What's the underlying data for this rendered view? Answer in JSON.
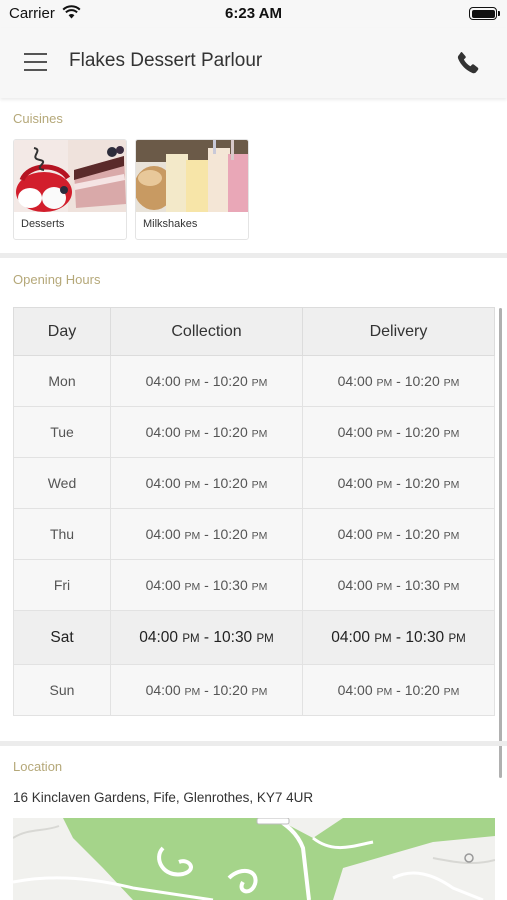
{
  "status_bar": {
    "carrier": "Carrier",
    "time": "6:23 AM"
  },
  "nav": {
    "title": "Flakes Dessert Parlour",
    "menu_icon": "hamburger-menu-icon",
    "phone_icon": "phone-icon"
  },
  "cuisines": {
    "label": "Cuisines",
    "items": [
      {
        "label": "Desserts",
        "icon": "desserts-photo"
      },
      {
        "label": "Milkshakes",
        "icon": "milkshakes-photo"
      }
    ]
  },
  "opening_hours": {
    "label": "Opening Hours",
    "headers": {
      "day": "Day",
      "collection": "Collection",
      "delivery": "Delivery"
    },
    "rows": [
      {
        "day": "Mon",
        "col_open": "04:00",
        "col_close": "10:20",
        "del_open": "04:00",
        "del_close": "10:20"
      },
      {
        "day": "Tue",
        "col_open": "04:00",
        "col_close": "10:20",
        "del_open": "04:00",
        "del_close": "10:20"
      },
      {
        "day": "Wed",
        "col_open": "04:00",
        "col_close": "10:20",
        "del_open": "04:00",
        "del_close": "10:20"
      },
      {
        "day": "Thu",
        "col_open": "04:00",
        "col_close": "10:20",
        "del_open": "04:00",
        "del_close": "10:20"
      },
      {
        "day": "Fri",
        "col_open": "04:00",
        "col_close": "10:30",
        "del_open": "04:00",
        "del_close": "10:30"
      },
      {
        "day": "Sat",
        "col_open": "04:00",
        "col_close": "10:30",
        "del_open": "04:00",
        "del_close": "10:30"
      },
      {
        "day": "Sun",
        "col_open": "04:00",
        "col_close": "10:20",
        "del_open": "04:00",
        "del_close": "10:20"
      }
    ],
    "meridiem": "PM",
    "separator": "-"
  },
  "location": {
    "label": "Location",
    "address": "16 Kinclaven Gardens, Fife, Glenrothes, KY7 4UR",
    "map_colors": {
      "park": "#a5d48a",
      "road": "#ffffff",
      "land": "#f1f1ee"
    }
  },
  "colors": {
    "section_label": "#b5a879",
    "divider": "#ececec",
    "table_header_bg": "#efefef"
  }
}
